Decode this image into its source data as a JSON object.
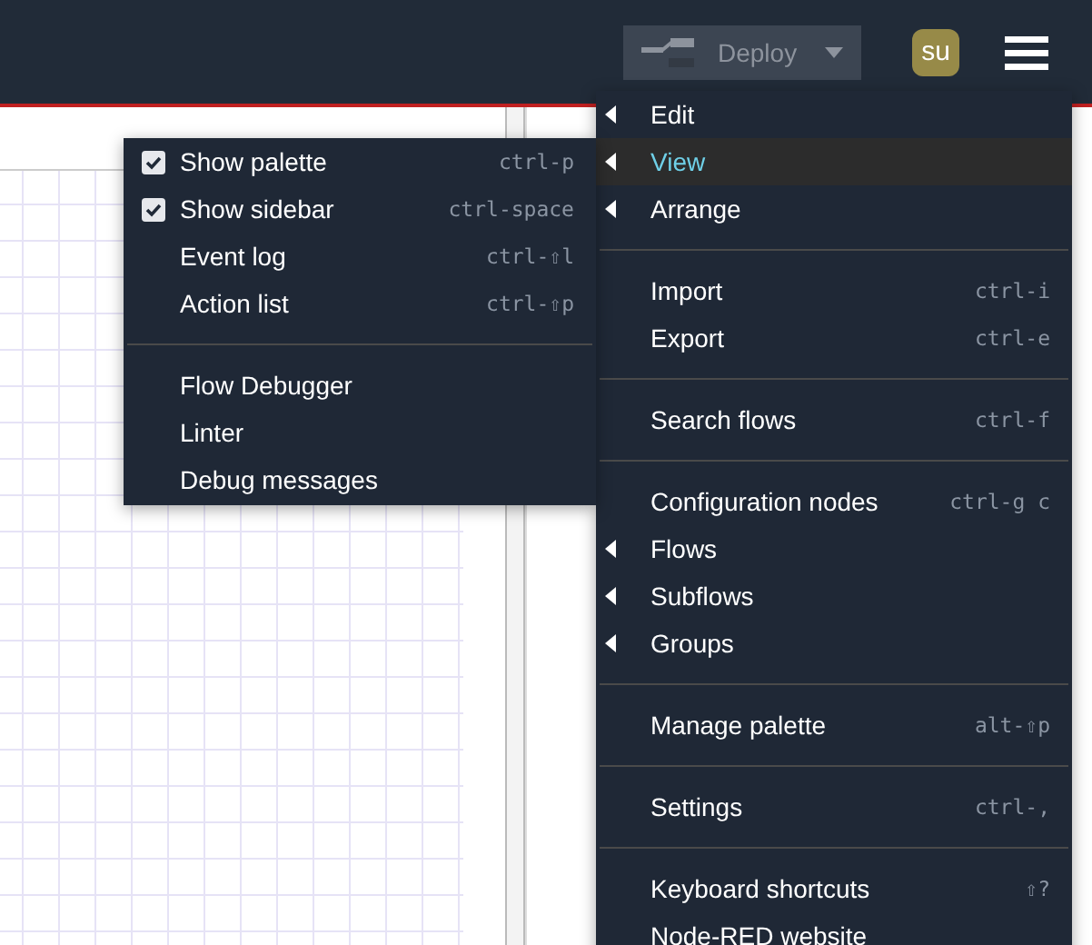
{
  "header": {
    "deploy": {
      "label": "Deploy",
      "disabled": true
    },
    "user": {
      "initials": "su"
    }
  },
  "main_menu": {
    "items": [
      {
        "kind": "item",
        "label": "Edit",
        "submenu": true,
        "selected": false
      },
      {
        "kind": "item",
        "label": "View",
        "submenu": true,
        "selected": true
      },
      {
        "kind": "item",
        "label": "Arrange",
        "submenu": true,
        "selected": false
      },
      {
        "kind": "divider"
      },
      {
        "kind": "item",
        "label": "Import",
        "shortcut": "ctrl-i",
        "submenu": false,
        "selected": false
      },
      {
        "kind": "item",
        "label": "Export",
        "shortcut": "ctrl-e",
        "submenu": false,
        "selected": false
      },
      {
        "kind": "divider"
      },
      {
        "kind": "item",
        "label": "Search flows",
        "shortcut": "ctrl-f",
        "submenu": false,
        "selected": false
      },
      {
        "kind": "divider"
      },
      {
        "kind": "item",
        "label": "Configuration nodes",
        "shortcut": "ctrl-g c",
        "submenu": false,
        "selected": false
      },
      {
        "kind": "item",
        "label": "Flows",
        "submenu": true,
        "selected": false
      },
      {
        "kind": "item",
        "label": "Subflows",
        "submenu": true,
        "selected": false
      },
      {
        "kind": "item",
        "label": "Groups",
        "submenu": true,
        "selected": false
      },
      {
        "kind": "divider"
      },
      {
        "kind": "item",
        "label": "Manage palette",
        "shortcut": "alt-⇧p",
        "submenu": false,
        "selected": false
      },
      {
        "kind": "divider"
      },
      {
        "kind": "item",
        "label": "Settings",
        "shortcut": "ctrl-,",
        "submenu": false,
        "selected": false
      },
      {
        "kind": "divider"
      },
      {
        "kind": "item",
        "label": "Keyboard shortcuts",
        "shortcut": "⇧?",
        "submenu": false,
        "selected": false
      },
      {
        "kind": "item",
        "label": "Node-RED website",
        "submenu": false,
        "selected": false
      }
    ]
  },
  "view_submenu": {
    "items": [
      {
        "kind": "toggle",
        "label": "Show palette",
        "shortcut": "ctrl-p",
        "checked": true
      },
      {
        "kind": "toggle",
        "label": "Show sidebar",
        "shortcut": "ctrl-space",
        "checked": true
      },
      {
        "kind": "action",
        "label": "Event log",
        "shortcut": "ctrl-⇧l"
      },
      {
        "kind": "action",
        "label": "Action list",
        "shortcut": "ctrl-⇧p"
      },
      {
        "kind": "divider"
      },
      {
        "kind": "action",
        "label": "Flow Debugger"
      },
      {
        "kind": "action",
        "label": "Linter"
      },
      {
        "kind": "action",
        "label": "Debug messages"
      }
    ]
  }
}
